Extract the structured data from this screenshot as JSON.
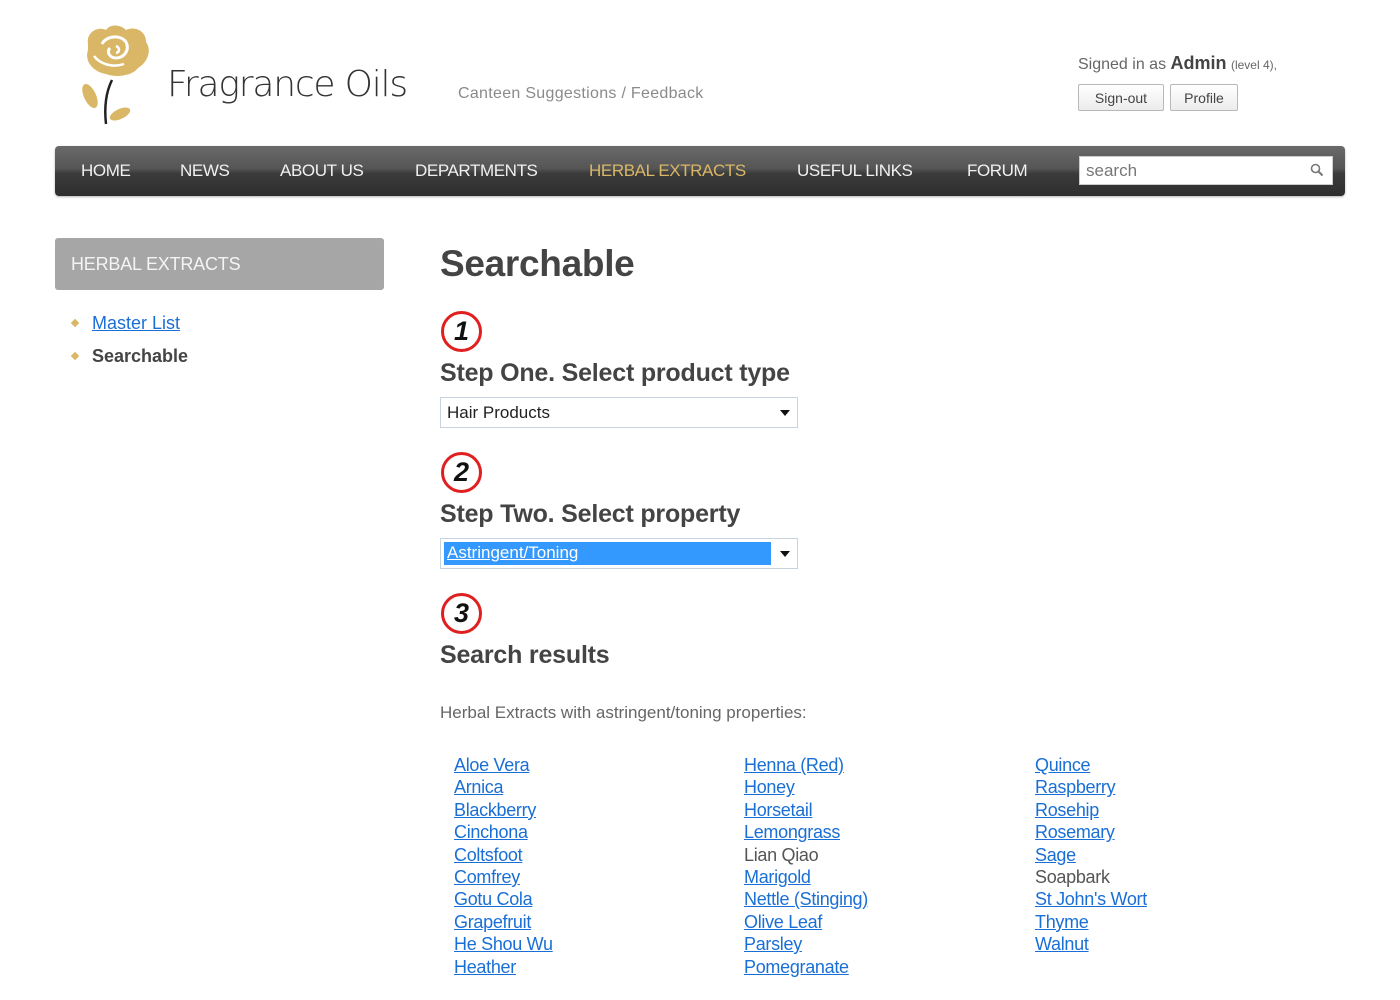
{
  "header": {
    "brand": "Fragrance Oils",
    "top_link": "Canteen Suggestions / Feedback",
    "signed_in_prefix": "Signed in as ",
    "user": "Admin",
    "user_level": "(level 4),",
    "signout_label": "Sign-out",
    "profile_label": "Profile"
  },
  "nav": {
    "items": [
      {
        "label": "HOME",
        "active": false
      },
      {
        "label": "NEWS",
        "active": false
      },
      {
        "label": "ABOUT US",
        "active": false
      },
      {
        "label": "DEPARTMENTS",
        "active": false
      },
      {
        "label": "HERBAL EXTRACTS",
        "active": true
      },
      {
        "label": "USEFUL LINKS",
        "active": false
      },
      {
        "label": "FORUM",
        "active": false
      }
    ],
    "search_placeholder": "search",
    "active_color": "#d9b766"
  },
  "sidebar": {
    "heading": "HERBAL EXTRACTS",
    "items": [
      {
        "label": "Master List",
        "link": true
      },
      {
        "label": "Searchable",
        "link": false
      }
    ]
  },
  "main": {
    "title": "Searchable",
    "steps": [
      {
        "number": "1",
        "title": "Step One. Select product type",
        "selected": "Hair Products"
      },
      {
        "number": "2",
        "title": "Step Two. Select property",
        "selected": "Astringent/Toning"
      },
      {
        "number": "3",
        "title": "Search results"
      }
    ],
    "results_intro": "Herbal Extracts with astringent/toning properties:",
    "results": [
      [
        {
          "label": "Aloe Vera",
          "link": true
        },
        {
          "label": "Arnica",
          "link": true
        },
        {
          "label": "Blackberry",
          "link": true
        },
        {
          "label": "Cinchona",
          "link": true
        },
        {
          "label": "Coltsfoot",
          "link": true
        },
        {
          "label": "Comfrey",
          "link": true
        },
        {
          "label": "Gotu Cola",
          "link": true
        },
        {
          "label": "Grapefruit",
          "link": true
        },
        {
          "label": "He Shou Wu",
          "link": true
        },
        {
          "label": "Heather",
          "link": true
        }
      ],
      [
        {
          "label": "Henna (Red)",
          "link": true
        },
        {
          "label": "Honey",
          "link": true
        },
        {
          "label": "Horsetail",
          "link": true
        },
        {
          "label": "Lemongrass",
          "link": true
        },
        {
          "label": "Lian Qiao",
          "link": false
        },
        {
          "label": "Marigold",
          "link": true
        },
        {
          "label": "Nettle (Stinging)",
          "link": true
        },
        {
          "label": "Olive Leaf",
          "link": true
        },
        {
          "label": "Parsley",
          "link": true
        },
        {
          "label": "Pomegranate",
          "link": true
        }
      ],
      [
        {
          "label": "Quince",
          "link": true
        },
        {
          "label": "Raspberry",
          "link": true
        },
        {
          "label": "Rosehip",
          "link": true
        },
        {
          "label": "Rosemary",
          "link": true
        },
        {
          "label": "Sage",
          "link": true
        },
        {
          "label": "Soapbark",
          "link": false
        },
        {
          "label": "St John's Wort",
          "link": true
        },
        {
          "label": "Thyme",
          "link": true
        },
        {
          "label": "Walnut",
          "link": true
        }
      ]
    ]
  },
  "colors": {
    "link": "#1a6fd6",
    "accent_gold": "#d9b766",
    "step_circle": "#e02020",
    "select_highlight": "#3399ff"
  }
}
